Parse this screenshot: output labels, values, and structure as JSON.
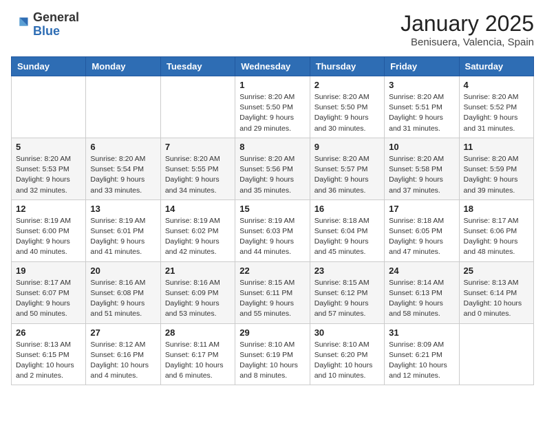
{
  "header": {
    "logo_general": "General",
    "logo_blue": "Blue",
    "month_title": "January 2025",
    "location": "Benisuera, Valencia, Spain"
  },
  "weekdays": [
    "Sunday",
    "Monday",
    "Tuesday",
    "Wednesday",
    "Thursday",
    "Friday",
    "Saturday"
  ],
  "weeks": [
    [
      {
        "day": "",
        "info": ""
      },
      {
        "day": "",
        "info": ""
      },
      {
        "day": "",
        "info": ""
      },
      {
        "day": "1",
        "info": "Sunrise: 8:20 AM\nSunset: 5:50 PM\nDaylight: 9 hours\nand 29 minutes."
      },
      {
        "day": "2",
        "info": "Sunrise: 8:20 AM\nSunset: 5:50 PM\nDaylight: 9 hours\nand 30 minutes."
      },
      {
        "day": "3",
        "info": "Sunrise: 8:20 AM\nSunset: 5:51 PM\nDaylight: 9 hours\nand 31 minutes."
      },
      {
        "day": "4",
        "info": "Sunrise: 8:20 AM\nSunset: 5:52 PM\nDaylight: 9 hours\nand 31 minutes."
      }
    ],
    [
      {
        "day": "5",
        "info": "Sunrise: 8:20 AM\nSunset: 5:53 PM\nDaylight: 9 hours\nand 32 minutes."
      },
      {
        "day": "6",
        "info": "Sunrise: 8:20 AM\nSunset: 5:54 PM\nDaylight: 9 hours\nand 33 minutes."
      },
      {
        "day": "7",
        "info": "Sunrise: 8:20 AM\nSunset: 5:55 PM\nDaylight: 9 hours\nand 34 minutes."
      },
      {
        "day": "8",
        "info": "Sunrise: 8:20 AM\nSunset: 5:56 PM\nDaylight: 9 hours\nand 35 minutes."
      },
      {
        "day": "9",
        "info": "Sunrise: 8:20 AM\nSunset: 5:57 PM\nDaylight: 9 hours\nand 36 minutes."
      },
      {
        "day": "10",
        "info": "Sunrise: 8:20 AM\nSunset: 5:58 PM\nDaylight: 9 hours\nand 37 minutes."
      },
      {
        "day": "11",
        "info": "Sunrise: 8:20 AM\nSunset: 5:59 PM\nDaylight: 9 hours\nand 39 minutes."
      }
    ],
    [
      {
        "day": "12",
        "info": "Sunrise: 8:19 AM\nSunset: 6:00 PM\nDaylight: 9 hours\nand 40 minutes."
      },
      {
        "day": "13",
        "info": "Sunrise: 8:19 AM\nSunset: 6:01 PM\nDaylight: 9 hours\nand 41 minutes."
      },
      {
        "day": "14",
        "info": "Sunrise: 8:19 AM\nSunset: 6:02 PM\nDaylight: 9 hours\nand 42 minutes."
      },
      {
        "day": "15",
        "info": "Sunrise: 8:19 AM\nSunset: 6:03 PM\nDaylight: 9 hours\nand 44 minutes."
      },
      {
        "day": "16",
        "info": "Sunrise: 8:18 AM\nSunset: 6:04 PM\nDaylight: 9 hours\nand 45 minutes."
      },
      {
        "day": "17",
        "info": "Sunrise: 8:18 AM\nSunset: 6:05 PM\nDaylight: 9 hours\nand 47 minutes."
      },
      {
        "day": "18",
        "info": "Sunrise: 8:17 AM\nSunset: 6:06 PM\nDaylight: 9 hours\nand 48 minutes."
      }
    ],
    [
      {
        "day": "19",
        "info": "Sunrise: 8:17 AM\nSunset: 6:07 PM\nDaylight: 9 hours\nand 50 minutes."
      },
      {
        "day": "20",
        "info": "Sunrise: 8:16 AM\nSunset: 6:08 PM\nDaylight: 9 hours\nand 51 minutes."
      },
      {
        "day": "21",
        "info": "Sunrise: 8:16 AM\nSunset: 6:09 PM\nDaylight: 9 hours\nand 53 minutes."
      },
      {
        "day": "22",
        "info": "Sunrise: 8:15 AM\nSunset: 6:11 PM\nDaylight: 9 hours\nand 55 minutes."
      },
      {
        "day": "23",
        "info": "Sunrise: 8:15 AM\nSunset: 6:12 PM\nDaylight: 9 hours\nand 57 minutes."
      },
      {
        "day": "24",
        "info": "Sunrise: 8:14 AM\nSunset: 6:13 PM\nDaylight: 9 hours\nand 58 minutes."
      },
      {
        "day": "25",
        "info": "Sunrise: 8:13 AM\nSunset: 6:14 PM\nDaylight: 10 hours\nand 0 minutes."
      }
    ],
    [
      {
        "day": "26",
        "info": "Sunrise: 8:13 AM\nSunset: 6:15 PM\nDaylight: 10 hours\nand 2 minutes."
      },
      {
        "day": "27",
        "info": "Sunrise: 8:12 AM\nSunset: 6:16 PM\nDaylight: 10 hours\nand 4 minutes."
      },
      {
        "day": "28",
        "info": "Sunrise: 8:11 AM\nSunset: 6:17 PM\nDaylight: 10 hours\nand 6 minutes."
      },
      {
        "day": "29",
        "info": "Sunrise: 8:10 AM\nSunset: 6:19 PM\nDaylight: 10 hours\nand 8 minutes."
      },
      {
        "day": "30",
        "info": "Sunrise: 8:10 AM\nSunset: 6:20 PM\nDaylight: 10 hours\nand 10 minutes."
      },
      {
        "day": "31",
        "info": "Sunrise: 8:09 AM\nSunset: 6:21 PM\nDaylight: 10 hours\nand 12 minutes."
      },
      {
        "day": "",
        "info": ""
      }
    ]
  ]
}
